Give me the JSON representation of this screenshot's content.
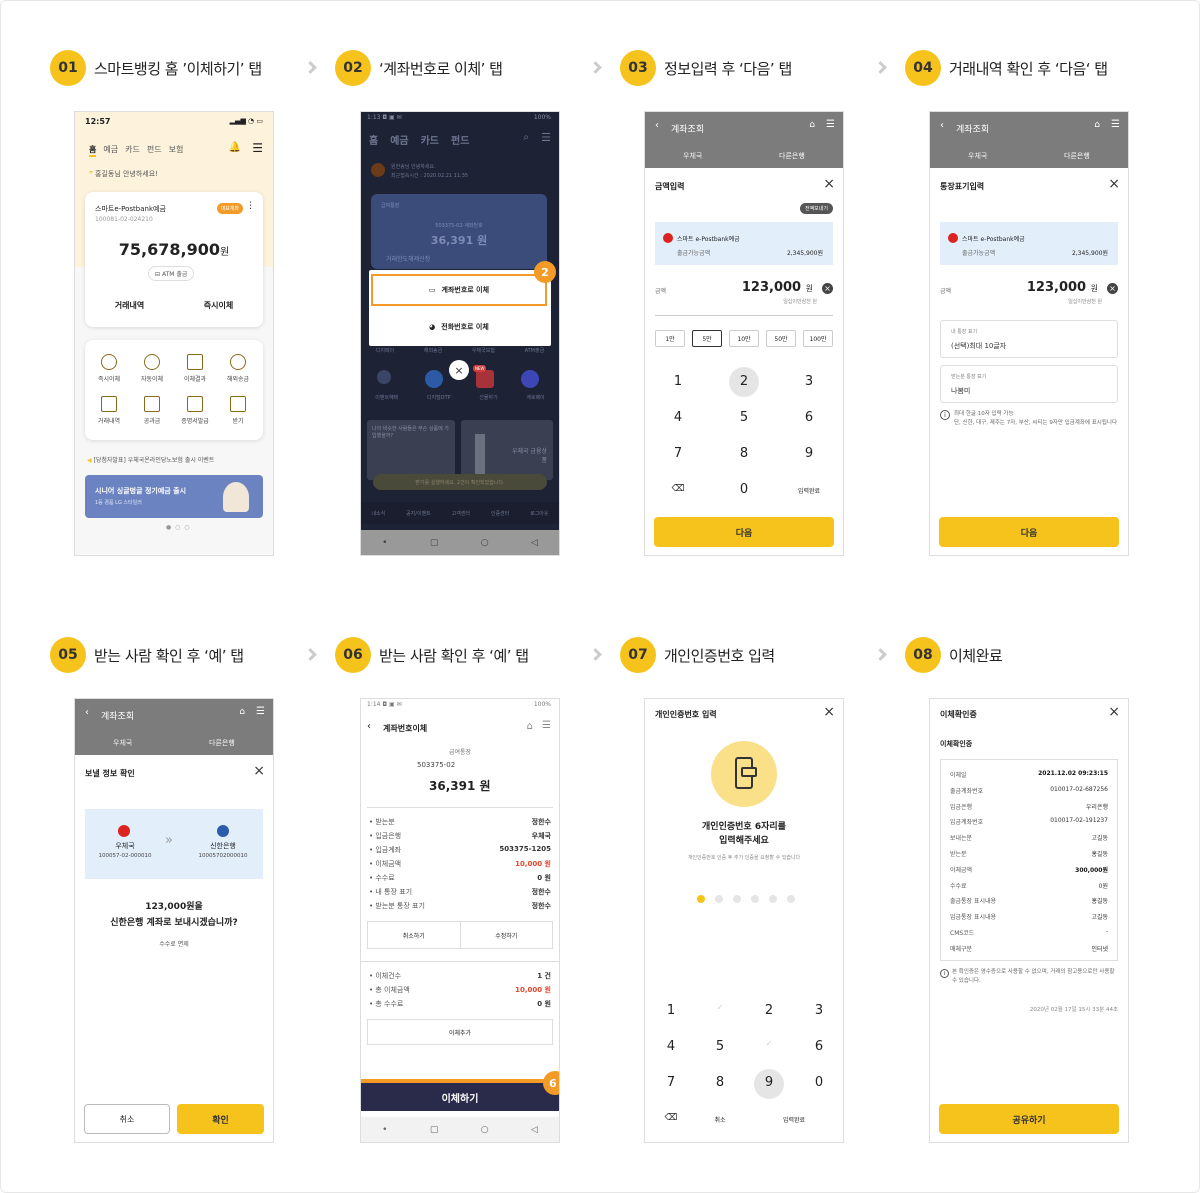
{
  "steps": [
    {
      "num": "01",
      "title": "스마트뱅킹 홈 ’이체하기’ 탭"
    },
    {
      "num": "02",
      "title": "‘계좌번호로 이체’ 탭"
    },
    {
      "num": "03",
      "title": "정보입력 후 ‘다음’ 탭"
    },
    {
      "num": "04",
      "title": "거래내역 확인 후 ‘다음‘ 탭"
    },
    {
      "num": "05",
      "title": "받는 사람 확인 후 ‘예’ 탭"
    },
    {
      "num": "06",
      "title": "받는 사람 확인 후 ‘예’ 탭"
    },
    {
      "num": "07",
      "title": "개인인증번호 입력"
    },
    {
      "num": "08",
      "title": "이체완료"
    }
  ],
  "s1": {
    "time": "12:57",
    "nav": [
      "홈",
      "예금",
      "카드",
      "펀드",
      "보험"
    ],
    "greet": "홍길동님 안녕하세요!",
    "acct_name": "스마트e-Postbank예금",
    "acct_no": "100081-02-024210",
    "badge": "대표계좌",
    "balance": "75,678,900",
    "won": "원",
    "atm": "ATM 출금",
    "hist": "거래내역",
    "instant": "즉시이체",
    "menu": [
      "즉시이체",
      "자동이체",
      "이체결과",
      "해외송금",
      "거래내역",
      "공과금",
      "증명서발급",
      "받기"
    ],
    "notice": "[당첨자발표] 우체국온라인당노보험 출시 이벤트",
    "banner_title": "시니어 싱글벙글 정기예금 출시",
    "banner_sub": "1등 경품 LG 스타일러"
  },
  "s2": {
    "status": "1:13 ◘ ▣ ✉",
    "battery": "100%",
    "nav": [
      "홈",
      "예금",
      "카드",
      "펀드"
    ],
    "greet": "원한송님 안녕하세요.",
    "last": "최근접속시간 : 2020.02.21 11:35",
    "card_title": "급여통장",
    "card_no": "503375-02-계좌번호",
    "card_amt": "36,391 원",
    "card_sub": "거래한도해제신청",
    "opt1": "계좌번호로 이체",
    "opt2": "전화번호로 이체",
    "badge": "2",
    "menu": [
      "디지페이",
      "해외송금",
      "우체국보험",
      "ATM출금",
      "이벤트혜택",
      "디지털OTP",
      "선물하기",
      "계로페이"
    ],
    "banner1": "나의 비슷한 사람들은 무슨 상품에 가입했을까?",
    "banner2": "우체국 금융상품",
    "toast": "받기를 실행하세요. 2건이 확인되었습니다.",
    "bottom": [
      "내소식",
      "공지/이벤트",
      "고객센터",
      "인증센터",
      "로그아웃"
    ],
    "new": "NEW"
  },
  "s3": {
    "hdr": "계좌조회",
    "tab1": "우체국",
    "tab2": "다른은행",
    "sheet_title": "금액입력",
    "all_btn": "전액보내기",
    "acct": "스마트 e-Postbank예금",
    "avail_label": "출금가능금액",
    "avail": "2,345,900원",
    "amt_label": "금액",
    "amt": "123,000",
    "won": "원",
    "amt_kor": "일십이만삼천 원",
    "quick": [
      "1만",
      "5만",
      "10만",
      "50만",
      "100만"
    ],
    "keys": [
      "1",
      "2",
      "3",
      "4",
      "5",
      "6",
      "7",
      "8",
      "9",
      "⌫",
      "0",
      "입력완료"
    ],
    "next": "다음"
  },
  "s4": {
    "hdr": "계좌조회",
    "tab1": "우체국",
    "tab2": "다른은행",
    "sheet_title": "통장표기입력",
    "acct": "스마트 e-Postbank예금",
    "avail_label": "출금가능금액",
    "avail": "2,345,900원",
    "amt_label": "금액",
    "amt": "123,000",
    "won": "원",
    "amt_kor": "일십이만삼천 원",
    "my_label": "내 통장 표기",
    "my_value": "(선택)최대 10글자",
    "their_label": "받는분 통장 표기",
    "their_value": "나봄미",
    "note": "최대 한글 10자 입력 가능\n단, 신한, 대구, 제주는 7자, 부산, 씨티는 9자만 입금계좌에 표시됩니다",
    "next": "다음"
  },
  "s5": {
    "hdr": "계좌조회",
    "tab1": "우체국",
    "tab2": "다른은행",
    "sheet_title": "보낼 정보 확인",
    "from_bank": "우체국",
    "from_no": "100057-02-000010",
    "to_bank": "신한은행",
    "to_no": "10005702000010",
    "msg1": "123,000원을",
    "msg2": "신한은행 계좌로 보내시겠습니까?",
    "fee": "수수료 면제",
    "cancel": "취소",
    "ok": "확인"
  },
  "s6": {
    "status": "1:14 ◘ ▣ ✉",
    "battery": "100%",
    "title": "계좌번호이체",
    "acct_label": "급여통장",
    "acct_no": "503375-02",
    "balance": "36,391 원",
    "rows": [
      [
        "받는분",
        "정한수"
      ],
      [
        "입금은행",
        "우체국"
      ],
      [
        "입금계좌",
        "503375-1205"
      ],
      [
        "이체금액",
        "10,000 원"
      ],
      [
        "수수료",
        "0 원"
      ],
      [
        "내 통장 표기",
        "정한수"
      ],
      [
        "받는분 통장 표기",
        "정한수"
      ]
    ],
    "cancel": "취소하기",
    "edit": "수정하기",
    "sum": [
      [
        "이체건수",
        "1 건"
      ],
      [
        "총 이체금액",
        "10,000 원"
      ],
      [
        "총 수수료",
        "0 원"
      ]
    ],
    "add": "이체추가",
    "submit": "이체하기",
    "badge": "6"
  },
  "s7": {
    "title": "개인인증번호 입력",
    "msg1": "개인인증번호 6자리를",
    "msg2": "입력해주세요",
    "sub": "개인인증번호 인증 후 추가 인증을 요청할 수 있습니다",
    "keys": [
      "1",
      "",
      "2",
      "3",
      "4",
      "5",
      "",
      "6",
      "7",
      "8",
      "9",
      "0",
      "⌫",
      "취소",
      "",
      "입력완료"
    ]
  },
  "s8": {
    "title": "이체확인증",
    "sub": "이체확인증",
    "rows": [
      [
        "이체일",
        "2021.12.02 09:23:15"
      ],
      [
        "출금계좌번호",
        "010017-02-687256"
      ],
      [
        "입금은행",
        "우리은행"
      ],
      [
        "입금계좌번호",
        "010017-02-191237"
      ],
      [
        "보내는분",
        "고길동"
      ],
      [
        "받는분",
        "홍길동"
      ],
      [
        "이체금액",
        "300,000원"
      ],
      [
        "수수료",
        "0원"
      ],
      [
        "출금통장 표시내용",
        "홍길동"
      ],
      [
        "입금통장 표시내용",
        "고길동"
      ],
      [
        "CMS코드",
        "-"
      ],
      [
        "매체구분",
        "인터넷"
      ]
    ],
    "note": "본 확인증은 영수증으로 사용할 수 없으며, 거래의 참고용으로만 사용할 수 있습니다.",
    "stamp": "2020년 02월 17일 15시 33분 44초",
    "share": "공유하기"
  }
}
